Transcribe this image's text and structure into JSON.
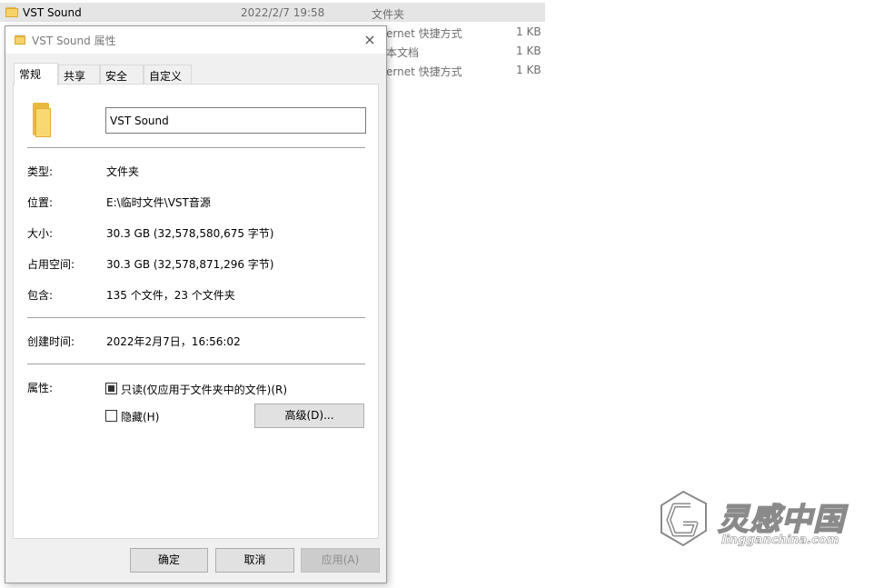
{
  "explorer": {
    "rows": [
      {
        "name": "VST Sound",
        "date": "2022/2/7 19:58",
        "type": "文件夹",
        "size": ""
      },
      {
        "name": "",
        "date": "",
        "type": "ernet 快捷方式",
        "size": "1 KB"
      },
      {
        "name": "",
        "date": "",
        "type": "本文档",
        "size": "1 KB"
      },
      {
        "name": "",
        "date": "",
        "type": "ernet 快捷方式",
        "size": "1 KB"
      }
    ]
  },
  "dialog": {
    "title": "VST Sound 属性",
    "close_icon": "×",
    "tabs": [
      {
        "label": "常规",
        "active": true
      },
      {
        "label": "共享",
        "active": false
      },
      {
        "label": "安全",
        "active": false
      },
      {
        "label": "自定义",
        "active": false
      }
    ],
    "name_value": "VST Sound",
    "fields": {
      "type_label": "类型:",
      "type_value": "文件夹",
      "location_label": "位置:",
      "location_value": "E:\\临时文件\\VST音源",
      "size_label": "大小:",
      "size_value": "30.3 GB (32,578,580,675 字节)",
      "disk_size_label": "占用空间:",
      "disk_size_value": "30.3 GB (32,578,871,296 字节)",
      "contains_label": "包含:",
      "contains_value": "135 个文件，23 个文件夹",
      "created_label": "创建时间:",
      "created_value": "2022年2月7日，16:56:02",
      "attributes_label": "属性:",
      "readonly_label": "只读(仅应用于文件夹中的文件)(R)",
      "readonly_state": "indeterminate",
      "hidden_label": "隐藏(H)",
      "hidden_state": "unchecked",
      "advanced_label": "高级(D)..."
    },
    "buttons": {
      "ok": "确定",
      "cancel": "取消",
      "apply": "应用(A)"
    }
  },
  "watermark": {
    "text": "灵感中国",
    "url": "lingganchina.com"
  },
  "colors": {
    "folder": "#f7d26b",
    "folder_dark": "#e8b93e",
    "dialog_bg": "#f0f0f0",
    "selected_row": "#e5e5e5"
  }
}
